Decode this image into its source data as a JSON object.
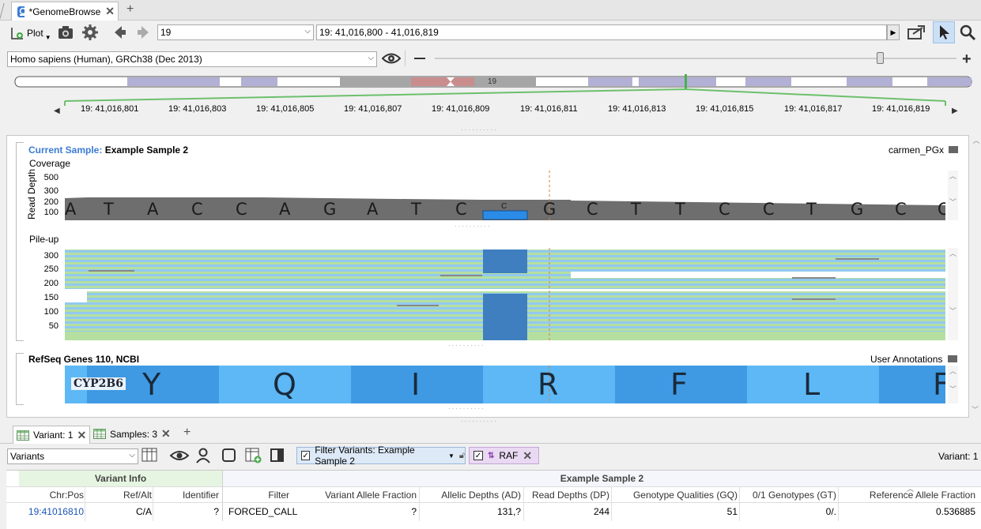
{
  "tabs": {
    "document_tab": "*GenomeBrowse"
  },
  "toolbar": {
    "plot_label": "Plot",
    "chromosome": "19",
    "location": "19: 41,016,800 - 41,016,819"
  },
  "genome": {
    "selected": "Homo sapiens (Human), GRCh38 (Dec 2013)"
  },
  "ideogram": {
    "chrom_label": "19"
  },
  "ruler": {
    "ticks": [
      "19: 41,016,801",
      "19: 41,016,803",
      "19: 41,016,805",
      "19: 41,016,807",
      "19: 41,016,809",
      "19: 41,016,811",
      "19: 41,016,813",
      "19: 41,016,815",
      "19: 41,016,817",
      "19: 41,016,819"
    ]
  },
  "sample_track": {
    "current_label": "Current Sample:",
    "current_value": "Example Sample 2",
    "source": "carmen_PGx",
    "coverage_title": "Coverage",
    "axis_label": "Read Depth",
    "yticks": [
      "500",
      "300",
      "200",
      "100"
    ],
    "bases": [
      "A",
      "T",
      "A",
      "C",
      "C",
      "A",
      "G",
      "A",
      "T",
      "C",
      "C",
      "G",
      "C",
      "T",
      "T",
      "C",
      "C",
      "T",
      "G",
      "C",
      "C"
    ],
    "variant_alt": "C"
  },
  "pileup": {
    "title": "Pile-up",
    "yticks": [
      "300",
      "250",
      "200",
      "150",
      "100",
      "50"
    ]
  },
  "genes": {
    "title": "RefSeq Genes 110, NCBI",
    "user_annotations": "User Annotations",
    "gene_name": "CYP2B6",
    "amino_acids": [
      "Y",
      "Q",
      "I",
      "R",
      "F",
      "L",
      "F"
    ]
  },
  "bottom_tabs": [
    {
      "label": "Variant: 1"
    },
    {
      "label": "Samples: 3"
    }
  ],
  "variants_bar": {
    "select": "Variants",
    "filter_label": "Filter Variants: Example Sample 2",
    "raf_label": "RAF",
    "count": "Variant:  1"
  },
  "table": {
    "group_variant": "Variant Info",
    "group_sample": "Example Sample 2",
    "headers": [
      "Chr:Pos",
      "Ref/Alt",
      "Identifier",
      "Filter",
      "Variant Allele Fraction",
      "Allelic Depths (AD)",
      "Read Depths (DP)",
      "Genotype Qualities (GQ)",
      "0/1 Genotypes (GT)",
      "Reference Allele Fraction"
    ],
    "rows": [
      [
        "19:41016810",
        "C/A",
        "?",
        "FORCED_CALL",
        "?",
        "131,?",
        "244",
        "51",
        "0/.",
        "0.536885"
      ]
    ]
  },
  "colors": {
    "accent": "#3a7bd5",
    "variant_blue": "#2b8ce8",
    "gene_light": "#5db8f5",
    "gene_dark": "#3f9ae3",
    "ideogram_band": "#b3b0d6",
    "centromere": "#c98d8d",
    "coverage_gray": "#6e6e6e",
    "read_green": "#b5dfa0",
    "read_blue": "#92c9f0"
  },
  "icons": [
    "app-icon",
    "add-track-icon",
    "camera-icon",
    "gear-icon",
    "back-arrow-icon",
    "forward-arrow-icon",
    "go-icon",
    "export-icon",
    "pointer-icon",
    "search-icon",
    "eye-icon",
    "minus-icon",
    "plus-icon",
    "folder-icon",
    "table-icon",
    "filter-icon"
  ]
}
